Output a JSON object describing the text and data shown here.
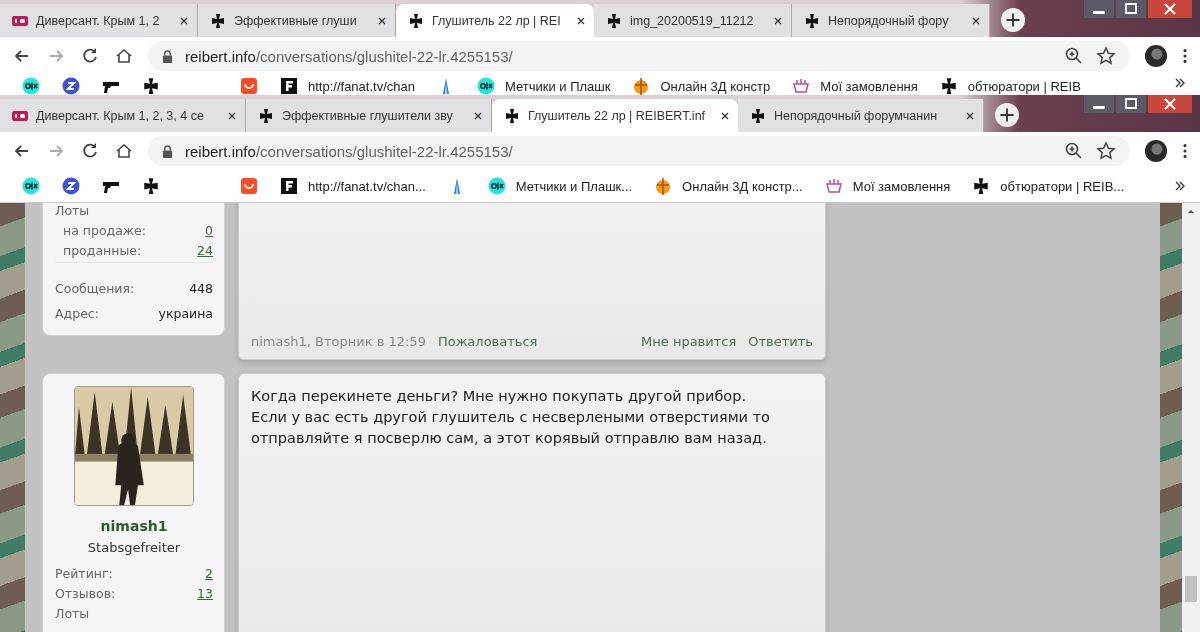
{
  "back_window": {
    "tabs": [
      {
        "title": "Диверсант. Крым 1, 2",
        "kind": "hd",
        "selected": false
      },
      {
        "title": "Эффективные глуши",
        "kind": "cross",
        "selected": false
      },
      {
        "title": "Глушитель 22 лр | REI",
        "kind": "cross",
        "selected": true
      },
      {
        "title": "img_20200519_11212",
        "kind": "cross",
        "selected": false
      },
      {
        "title": "Непорядочный фору",
        "kind": "cross",
        "selected": false
      }
    ],
    "address": {
      "domain": "reibert.info",
      "path": "/conversations/glushitel-22-lr.4255153/"
    },
    "bookmarks": [
      {
        "kind": "olx"
      },
      {
        "kind": "zig"
      },
      {
        "kind": "gun"
      },
      {
        "kind": "cross"
      },
      {
        "kind": "gap"
      },
      {
        "kind": "ali"
      },
      {
        "kind": "fbox",
        "label": "http://fanat.tv/chan"
      },
      {
        "kind": "tower"
      },
      {
        "kind": "olx",
        "label": "Метчики и Плашк"
      },
      {
        "kind": "ball",
        "label": "Онлайн 3Д констр"
      },
      {
        "kind": "bars",
        "label": "Мої замовлення"
      },
      {
        "kind": "cross",
        "label": "обтюратори | REIB"
      }
    ]
  },
  "front_window": {
    "tabs": [
      {
        "title": "Диверсант. Крым 1, 2, 3, 4 се",
        "kind": "hd",
        "selected": false
      },
      {
        "title": "Эффективные глушители зву",
        "kind": "cross",
        "selected": false
      },
      {
        "title": "Глушитель 22 лр | REIBERT.inf",
        "kind": "cross",
        "selected": true
      },
      {
        "title": "Непорядочный форумчанин",
        "kind": "cross",
        "selected": false
      }
    ],
    "address": {
      "domain": "reibert.info",
      "path": "/conversations/glushitel-22-lr.4255153/"
    },
    "bookmarks": [
      {
        "kind": "olx"
      },
      {
        "kind": "zig"
      },
      {
        "kind": "gun"
      },
      {
        "kind": "cross"
      },
      {
        "kind": "gap"
      },
      {
        "kind": "ali"
      },
      {
        "kind": "fbox",
        "label": "http://fanat.tv/chan..."
      },
      {
        "kind": "tower"
      },
      {
        "kind": "olx",
        "label": "Метчики и Плашк..."
      },
      {
        "kind": "ball",
        "label": "Онлайн 3Д констр..."
      },
      {
        "kind": "bars",
        "label": "Мої замовлення"
      },
      {
        "kind": "cross",
        "label": "обтюратори | REIB..."
      }
    ]
  },
  "posts": [
    {
      "user": {
        "stats": [
          {
            "kind": "heading",
            "label": "Лоты"
          },
          {
            "kind": "stat",
            "label": "на продаже:",
            "value": "0",
            "link": true,
            "indent": true
          },
          {
            "kind": "stat",
            "label": "проданные:",
            "value": "24",
            "link": true,
            "indent": true
          },
          {
            "kind": "stat",
            "label": "Сообщения:",
            "value": "448",
            "link": false,
            "indent": false,
            "gap": true
          },
          {
            "kind": "stat",
            "label": "Адрес:",
            "value": "украина",
            "link": false,
            "indent": false
          }
        ]
      },
      "footer": {
        "meta": "nimash1, Вторник в 12:59",
        "report": "Пожаловаться",
        "like": "Мне нравится",
        "reply": "Ответить"
      }
    },
    {
      "user": {
        "name": "nimash1",
        "rank": "Stabsgefreiter",
        "stats": [
          {
            "kind": "stat",
            "label": "Рейтинг:",
            "value": "2",
            "link": true,
            "indent": false
          },
          {
            "kind": "stat",
            "label": "Отзывов:",
            "value": "13",
            "link": true,
            "indent": false
          },
          {
            "kind": "heading",
            "label": "Лоты"
          }
        ]
      },
      "message": "Когда перекинете деньги? Мне нужно покупать другой прибор.\nЕсли у вас есть другой глушитель с несверлеными отверстиями то\nотправляйте я посверлю сам, а этот корявый отправлю вам назад."
    }
  ]
}
